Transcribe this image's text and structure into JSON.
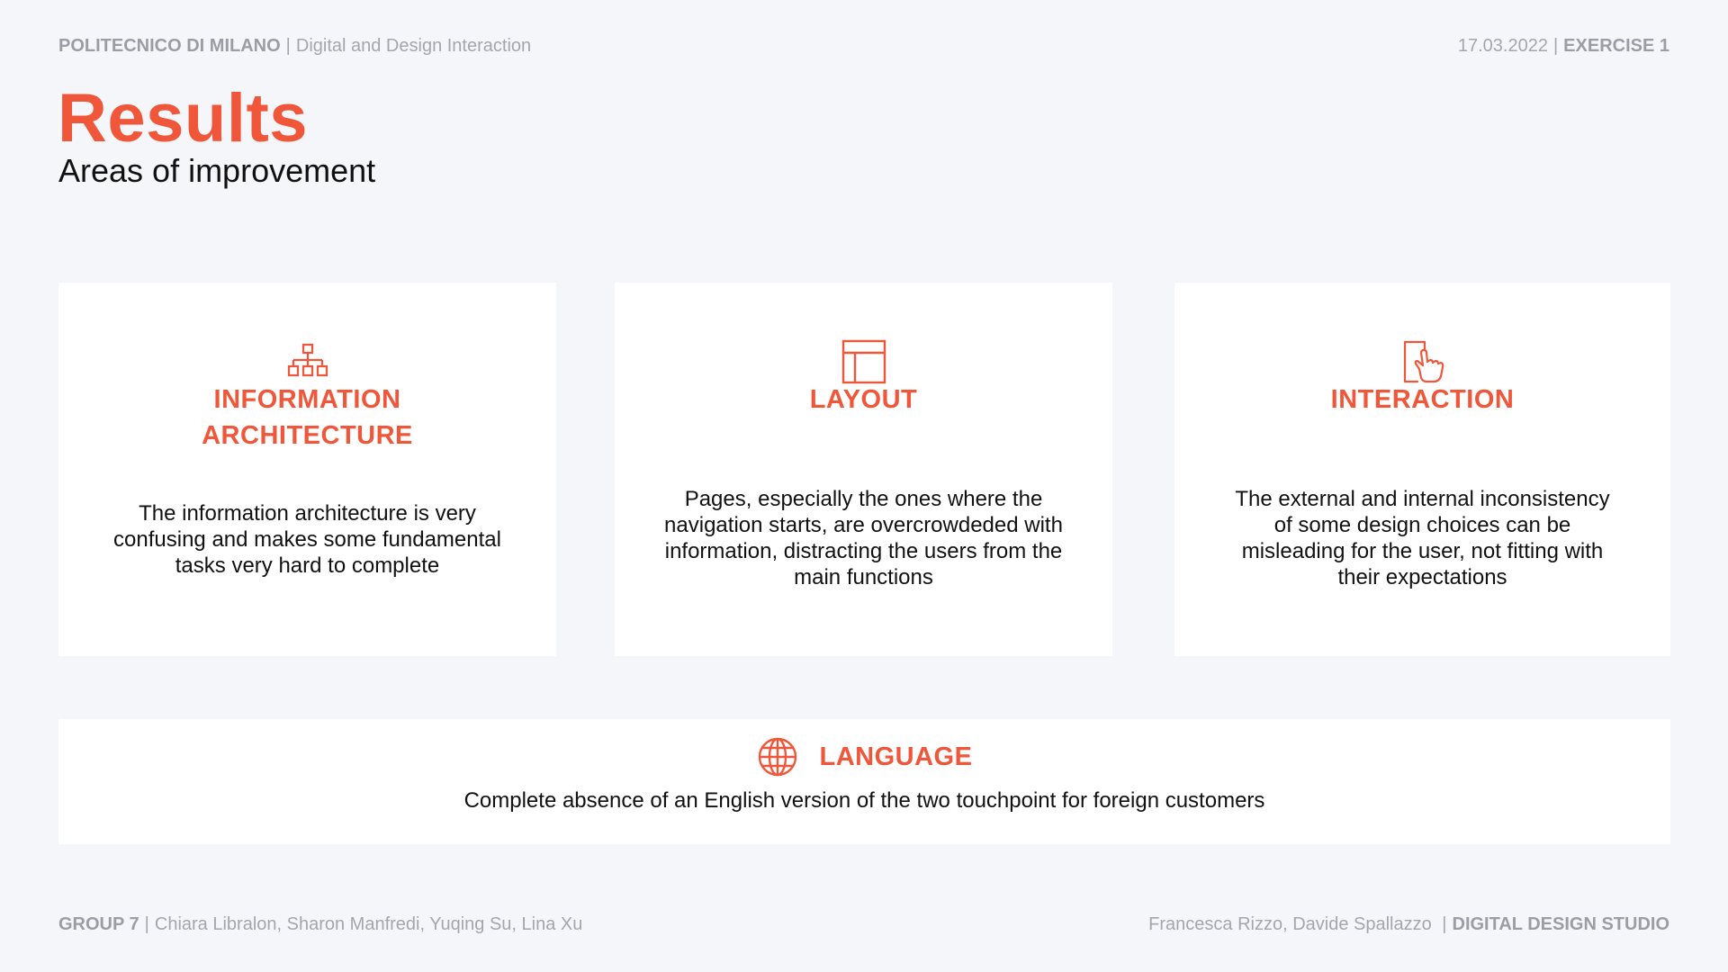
{
  "header": {
    "institution": "POLITECNICO DI MILANO",
    "course": "Digital and Design Interaction",
    "date": "17.03.2022",
    "exercise": "EXERCISE 1"
  },
  "page": {
    "title": "Results",
    "subtitle": "Areas of improvement"
  },
  "cards": [
    {
      "icon": "sitemap-icon",
      "title_line1": "INFORMATION",
      "title_line2": "ARCHITECTURE",
      "body": "The information architecture is very confusing and makes some fundamental tasks very hard to complete"
    },
    {
      "icon": "layout-icon",
      "title": "LAYOUT",
      "body": "Pages, especially the ones where the navigation starts, are overcrowdeded with information, distracting the users from the main functions"
    },
    {
      "icon": "touch-icon",
      "title": "INTERACTION",
      "body": "The external and internal inconsistency of some design choices can be misleading for the user, not fitting with their expectations"
    }
  ],
  "language": {
    "icon": "globe-icon",
    "title": "LANGUAGE",
    "body": "Complete absence of an English version of the two touchpoint for foreign customers"
  },
  "footer": {
    "group": "GROUP 7",
    "members": "Chiara Libralon, Sharon Manfredi, Yuqing Su, Lina Xu",
    "professors": "Francesca Rizzo, Davide Spallazzo",
    "studio": "DIGITAL DESIGN STUDIO"
  },
  "colors": {
    "accent": "#f0573a",
    "background": "#f5f6fa",
    "muted": "#a3a6ad"
  }
}
